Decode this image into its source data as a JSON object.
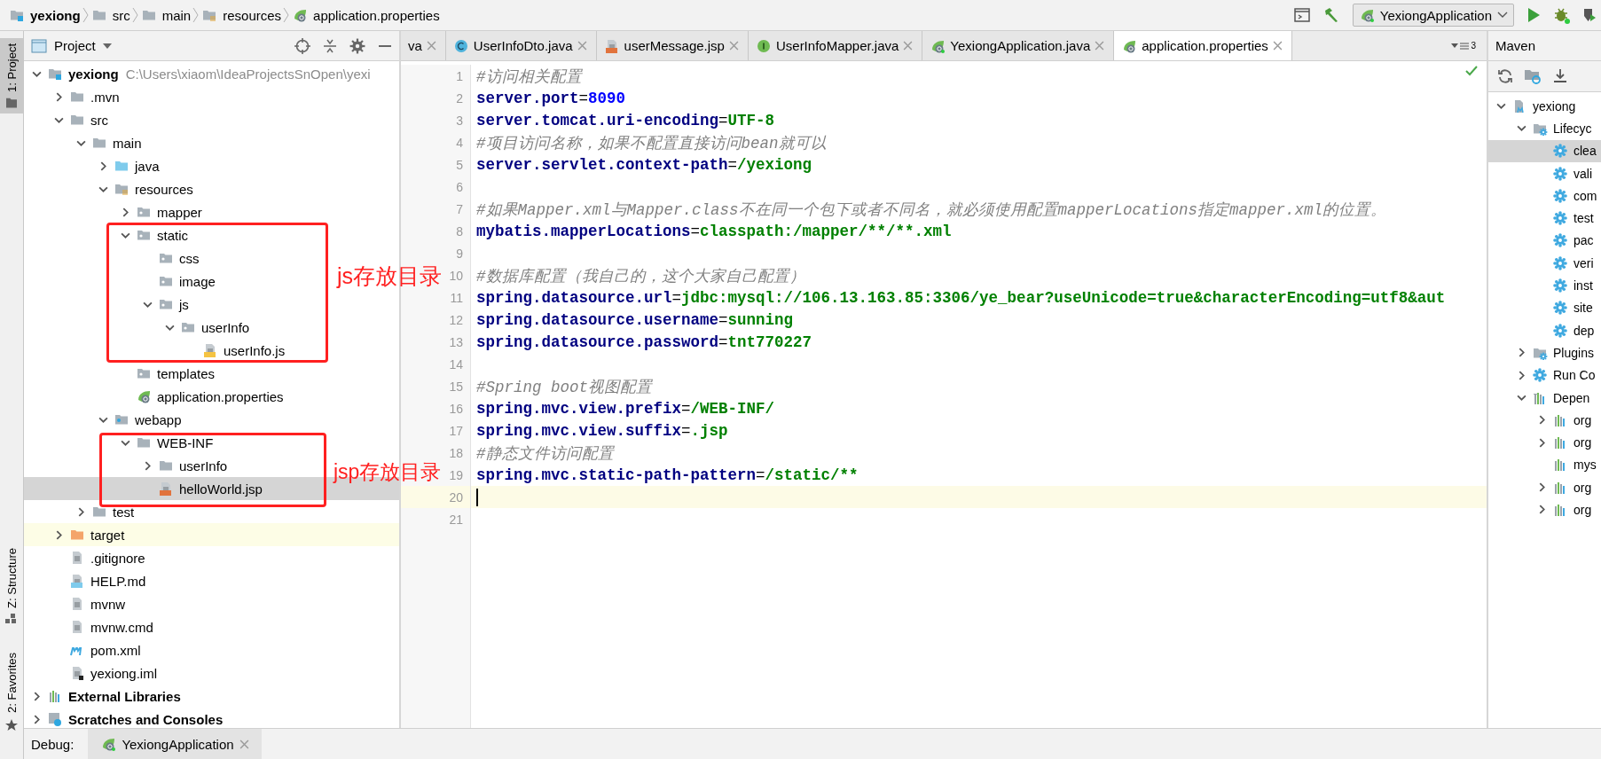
{
  "breadcrumb": [
    {
      "label": "yexiong",
      "kind": "module"
    },
    {
      "label": "src",
      "kind": "folder"
    },
    {
      "label": "main",
      "kind": "folder"
    },
    {
      "label": "resources",
      "kind": "resource-folder"
    },
    {
      "label": "application.properties",
      "kind": "spring-file"
    }
  ],
  "run_config": "YexiongApplication",
  "tool_strip": [
    {
      "label": "1: Project",
      "selected": true
    },
    {
      "label": "Z: Structure",
      "selected": false
    },
    {
      "label": "2: Favorites",
      "selected": false
    }
  ],
  "project_panel": {
    "title": "Project",
    "tree": [
      {
        "label": "yexiong",
        "path": "C:\\Users\\xiaom\\IdeaProjectsSnOpen\\yexi",
        "kind": "module",
        "expanded": true,
        "selected": false,
        "children": [
          {
            "label": ".mvn",
            "kind": "folder",
            "expanded": false,
            "selected": false
          },
          {
            "label": "src",
            "kind": "folder",
            "expanded": true,
            "selected": false,
            "children": [
              {
                "label": "main",
                "kind": "folder",
                "expanded": true,
                "selected": false,
                "children": [
                  {
                    "label": "java",
                    "kind": "source-folder",
                    "expanded": false,
                    "selected": false
                  },
                  {
                    "label": "resources",
                    "kind": "resource-folder",
                    "expanded": true,
                    "selected": false,
                    "children": [
                      {
                        "label": "mapper",
                        "kind": "package-folder",
                        "expanded": false,
                        "selected": false
                      },
                      {
                        "label": "static",
                        "kind": "package-folder",
                        "expanded": true,
                        "selected": false,
                        "children": [
                          {
                            "label": "css",
                            "kind": "package-folder",
                            "selected": false
                          },
                          {
                            "label": "image",
                            "kind": "package-folder",
                            "selected": false
                          },
                          {
                            "label": "js",
                            "kind": "package-folder",
                            "expanded": true,
                            "selected": false,
                            "children": [
                              {
                                "label": "userInfo",
                                "kind": "package-folder",
                                "expanded": true,
                                "selected": false,
                                "children": [
                                  {
                                    "label": "userInfo.js",
                                    "kind": "js-file",
                                    "selected": false
                                  }
                                ]
                              }
                            ]
                          }
                        ]
                      },
                      {
                        "label": "templates",
                        "kind": "package-folder",
                        "selected": false
                      },
                      {
                        "label": "application.properties",
                        "kind": "spring-file",
                        "selected": false
                      }
                    ]
                  },
                  {
                    "label": "webapp",
                    "kind": "web-folder",
                    "expanded": true,
                    "selected": false,
                    "children": [
                      {
                        "label": "WEB-INF",
                        "kind": "folder",
                        "expanded": true,
                        "selected": false,
                        "children": [
                          {
                            "label": "userInfo",
                            "kind": "folder",
                            "expanded": false,
                            "selected": false
                          },
                          {
                            "label": "helloWorld.jsp",
                            "kind": "jsp-file",
                            "selected": true
                          }
                        ]
                      }
                    ]
                  }
                ]
              },
              {
                "label": "test",
                "kind": "folder",
                "expanded": false,
                "selected": false
              }
            ]
          },
          {
            "label": "target",
            "kind": "excluded-folder",
            "expanded": false,
            "selected": false,
            "highlighted": true
          },
          {
            "label": ".gitignore",
            "kind": "text-file",
            "selected": false
          },
          {
            "label": "HELP.md",
            "kind": "md-file",
            "selected": false
          },
          {
            "label": "mvnw",
            "kind": "text-file",
            "selected": false
          },
          {
            "label": "mvnw.cmd",
            "kind": "text-file",
            "selected": false
          },
          {
            "label": "pom.xml",
            "kind": "maven-file",
            "selected": false
          },
          {
            "label": "yexiong.iml",
            "kind": "iml-file",
            "selected": false
          }
        ]
      },
      {
        "label": "External Libraries",
        "kind": "libraries",
        "expanded": false,
        "selected": false
      },
      {
        "label": "Scratches and Consoles",
        "kind": "scratches",
        "expanded": false,
        "selected": false
      }
    ]
  },
  "editor": {
    "tabs": [
      {
        "label": "va",
        "kind": "none",
        "selected": false
      },
      {
        "label": "UserInfoDto.java",
        "kind": "class",
        "selected": false
      },
      {
        "label": "userMessage.jsp",
        "kind": "jsp-file",
        "selected": false
      },
      {
        "label": "UserInfoMapper.java",
        "kind": "interface",
        "selected": false
      },
      {
        "label": "YexiongApplication.java",
        "kind": "spring-app",
        "selected": false
      },
      {
        "label": "application.properties",
        "kind": "spring-file",
        "selected": true
      }
    ],
    "tab_overflow": "3",
    "lines": [
      {
        "number": "1",
        "kind": "comment",
        "text": "#访问相关配置",
        "current": false
      },
      {
        "number": "2",
        "kind": "numeric-property",
        "key": "server.port",
        "separator": "=",
        "value": "8090",
        "current": false
      },
      {
        "number": "3",
        "kind": "property",
        "key": "server.tomcat.uri-encoding",
        "separator": "=",
        "value": "UTF-8",
        "current": false
      },
      {
        "number": "4",
        "kind": "comment",
        "text": "#项目访问名称，如果不配置直接访问bean就可以",
        "current": false
      },
      {
        "number": "5",
        "kind": "property",
        "key": "server.servlet.context-path",
        "separator": "=",
        "value": "/yexiong",
        "current": false
      },
      {
        "number": "6",
        "kind": "blank",
        "current": false
      },
      {
        "number": "7",
        "kind": "comment",
        "text": "#如果Mapper.xml与Mapper.class不在同一个包下或者不同名，就必须使用配置mapperLocations指定mapper.xml的位置。",
        "current": false
      },
      {
        "number": "8",
        "kind": "property",
        "key": "mybatis.mapperLocations",
        "separator": "=",
        "value": "classpath:/mapper/**/**.xml",
        "current": false
      },
      {
        "number": "9",
        "kind": "blank",
        "current": false
      },
      {
        "number": "10",
        "kind": "comment",
        "text": "#数据库配置（我自己的，这个大家自己配置）",
        "current": false
      },
      {
        "number": "11",
        "kind": "property",
        "key": "spring.datasource.url",
        "separator": "=",
        "value": "jdbc:mysql://106.13.163.85:3306/ye_bear?useUnicode=true&characterEncoding=utf8&aut",
        "current": false
      },
      {
        "number": "12",
        "kind": "property",
        "key": "spring.datasource.username",
        "separator": "=",
        "value": "sunning",
        "current": false
      },
      {
        "number": "13",
        "kind": "property",
        "key": "spring.datasource.password",
        "separator": "=",
        "value": "tnt770227",
        "current": false
      },
      {
        "number": "14",
        "kind": "blank",
        "current": false
      },
      {
        "number": "15",
        "kind": "comment",
        "text": "#Spring boot视图配置",
        "current": false
      },
      {
        "number": "16",
        "kind": "property",
        "key": "spring.mvc.view.prefix",
        "separator": "=",
        "value": "/WEB-INF/",
        "current": false
      },
      {
        "number": "17",
        "kind": "property",
        "key": "spring.mvc.view.suffix",
        "separator": "=",
        "value": ".jsp",
        "current": false
      },
      {
        "number": "18",
        "kind": "comment",
        "text": "#静态文件访问配置",
        "current": false
      },
      {
        "number": "19",
        "kind": "property",
        "key": "spring.mvc.static-path-pattern",
        "separator": "=",
        "value": "/static/**",
        "current": false
      },
      {
        "number": "20",
        "kind": "blank",
        "current": true
      },
      {
        "number": "21",
        "kind": "blank",
        "current": false
      }
    ]
  },
  "maven_panel": {
    "title": "Maven",
    "tree": [
      {
        "label": "yexiong",
        "kind": "maven-module",
        "expanded": true,
        "selected": false,
        "children": [
          {
            "label": "Lifecyc",
            "kind": "lifecycle",
            "expanded": true,
            "selected": false,
            "children": [
              {
                "label": "clea",
                "kind": "goal",
                "selected": true
              },
              {
                "label": "vali",
                "kind": "goal",
                "selected": false
              },
              {
                "label": "com",
                "kind": "goal",
                "selected": false
              },
              {
                "label": "test",
                "kind": "goal",
                "selected": false
              },
              {
                "label": "pac",
                "kind": "goal",
                "selected": false
              },
              {
                "label": "veri",
                "kind": "goal",
                "selected": false
              },
              {
                "label": "inst",
                "kind": "goal",
                "selected": false
              },
              {
                "label": "site",
                "kind": "goal",
                "selected": false
              },
              {
                "label": "dep",
                "kind": "goal",
                "selected": false
              }
            ]
          },
          {
            "label": "Plugins",
            "kind": "lifecycle",
            "expanded": false,
            "selected": false
          },
          {
            "label": "Run Co",
            "kind": "goal",
            "expanded": false,
            "selected": false
          },
          {
            "label": "Depen",
            "kind": "dependencies",
            "expanded": true,
            "selected": false,
            "children": [
              {
                "label": "org",
                "kind": "library",
                "expanded": false,
                "selected": false
              },
              {
                "label": "org",
                "kind": "library",
                "expanded": false,
                "selected": false
              },
              {
                "label": "mys",
                "kind": "library",
                "selected": false
              },
              {
                "label": "org",
                "kind": "library",
                "expanded": false,
                "selected": false
              },
              {
                "label": "org",
                "kind": "library",
                "expanded": false,
                "selected": false
              }
            ]
          }
        ]
      }
    ]
  },
  "annotations": [
    {
      "text": "js存放目录"
    },
    {
      "text": "jsp存放目录"
    }
  ],
  "debug_bar": {
    "label": "Debug:",
    "tabs": [
      {
        "label": "YexiongApplication",
        "kind": "spring-app"
      }
    ]
  }
}
